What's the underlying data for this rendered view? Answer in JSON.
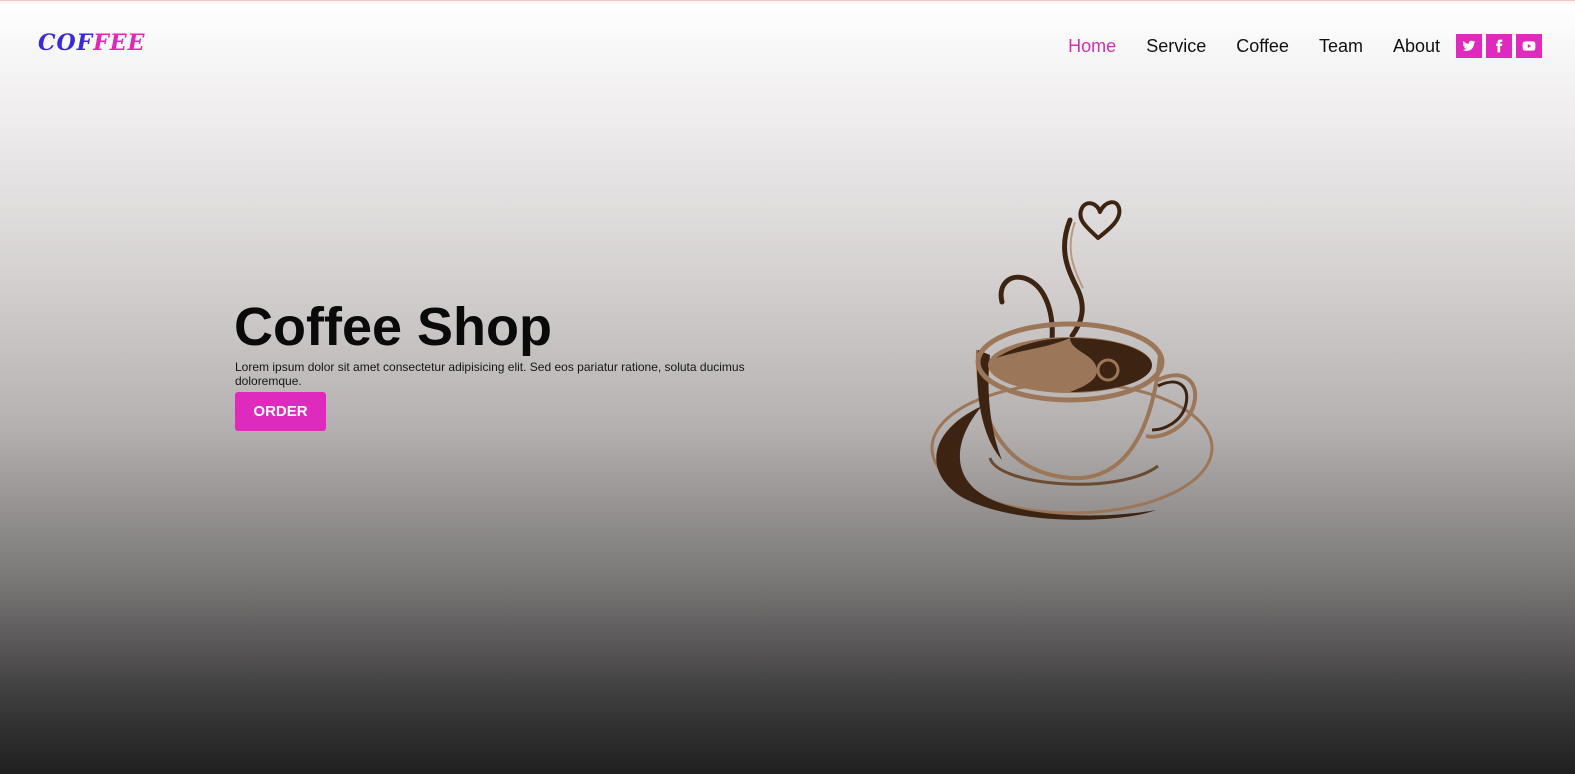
{
  "brand": {
    "logo_part1": "COF",
    "logo_part2": "FEE"
  },
  "nav": {
    "items": [
      {
        "label": "Home",
        "active": true
      },
      {
        "label": "Service"
      },
      {
        "label": "Coffee"
      },
      {
        "label": "Team"
      },
      {
        "label": "About"
      }
    ]
  },
  "socials": [
    {
      "icon": "twitter-icon"
    },
    {
      "icon": "facebook-icon"
    },
    {
      "icon": "youtube-icon"
    }
  ],
  "hero": {
    "title": "Coffee Shop",
    "text": "Lorem ipsum dolor sit amet consectetur adipisicing elit. Sed eos pariatur ratione, soluta ducimus doloremque.",
    "button_label": "ORDER",
    "illustration": "coffee-cup-illustration"
  },
  "colors": {
    "accent": "#df2bbd",
    "logo_blue": "#3a2ad8",
    "coffee_dark": "#3d2412",
    "coffee_light": "#9b7658"
  }
}
